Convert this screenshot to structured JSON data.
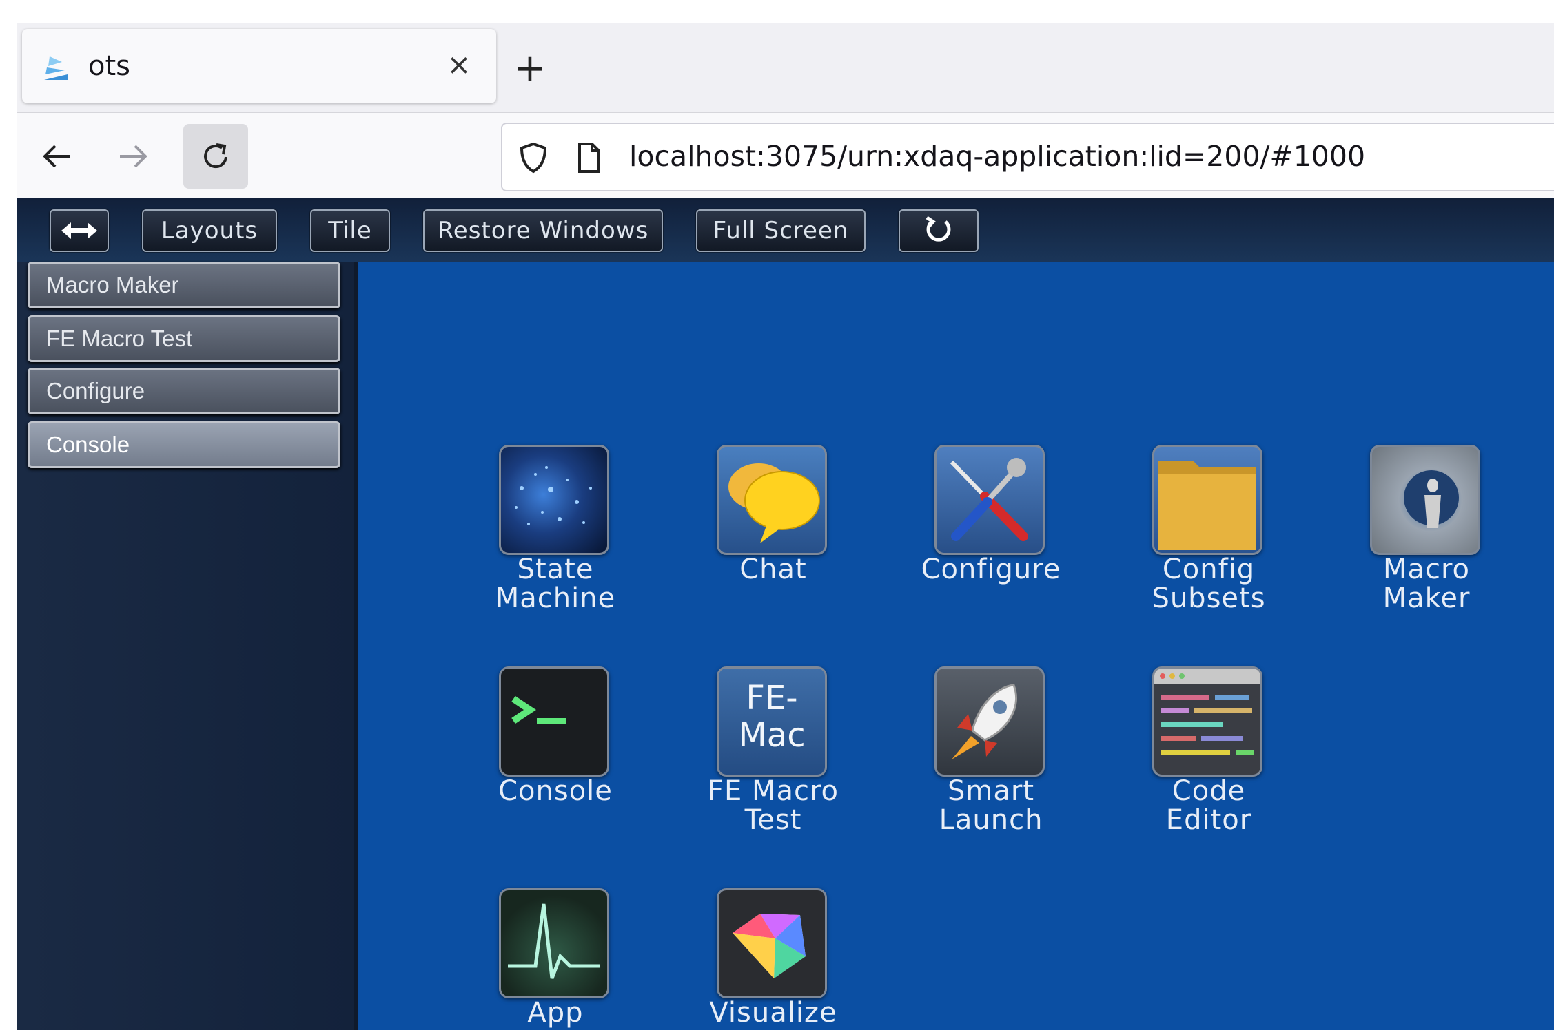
{
  "browser": {
    "tab_title": "ots",
    "tab_close": "×",
    "new_tab": "+",
    "url": "localhost:3075/urn:xdaq-application:lid=200/#1000"
  },
  "toolbar": {
    "expand_icon": "expand-icon",
    "layouts": "Layouts",
    "tile": "Tile",
    "restore_windows": "Restore Windows",
    "full_screen": "Full Screen",
    "refresh_icon": "refresh-icon"
  },
  "sidebar": {
    "items": [
      "Macro Maker",
      "FE Macro Test",
      "Configure",
      "Console"
    ],
    "active_index": 3
  },
  "desktop": {
    "icons": [
      {
        "label": "State\nMachine",
        "icon": "state-machine-icon"
      },
      {
        "label": "Chat",
        "icon": "chat-icon"
      },
      {
        "label": "Configure",
        "icon": "configure-icon"
      },
      {
        "label": "Config\nSubsets",
        "icon": "folder-icon"
      },
      {
        "label": "Macro\nMaker",
        "icon": "macro-maker-icon"
      },
      {
        "label": "Console",
        "icon": "terminal-icon"
      },
      {
        "label": "FE Macro\nTest",
        "icon": "fe-mac-icon",
        "tile_text": "FE-\nMac"
      },
      {
        "label": "Smart\nLaunch",
        "icon": "rocket-icon"
      },
      {
        "label": "Code\nEditor",
        "icon": "code-editor-icon"
      },
      {
        "label": "App\nStatus",
        "icon": "heartbeat-icon"
      },
      {
        "label": "Visualize",
        "icon": "visualize-icon"
      }
    ]
  },
  "colors": {
    "desktop_bg": "#0b4fa3",
    "toolbar_bg": "#11203a",
    "sidebar_bg": "#1a2a44"
  }
}
